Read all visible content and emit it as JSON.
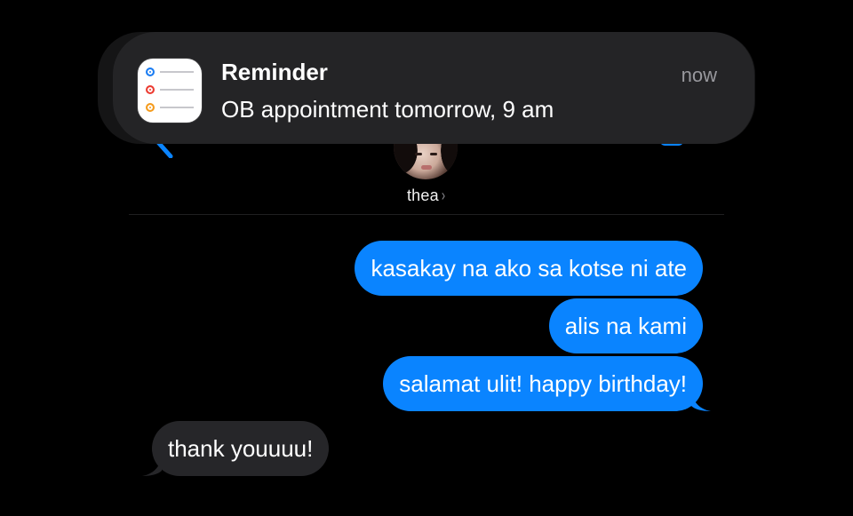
{
  "notification": {
    "app_icon": "reminders-icon",
    "title": "Reminder",
    "body": "OB appointment tomorrow, 9 am",
    "time": "now"
  },
  "conversation": {
    "contact_name": "thea",
    "contact_chevron": "›",
    "avatar": "contact-avatar-photo"
  },
  "messages": [
    {
      "direction": "sent",
      "text": "kasakay na ako sa kotse ni ate"
    },
    {
      "direction": "sent",
      "text": "alis na kami"
    },
    {
      "direction": "sent",
      "text": "salamat ulit! happy birthday!"
    },
    {
      "direction": "received",
      "text": "thank youuuu!"
    }
  ],
  "colors": {
    "background": "#000000",
    "sent_bubble": "#0a84ff",
    "received_bubble": "#262629",
    "notification_bg": "#242426",
    "accent_blue": "#0a84ff"
  }
}
